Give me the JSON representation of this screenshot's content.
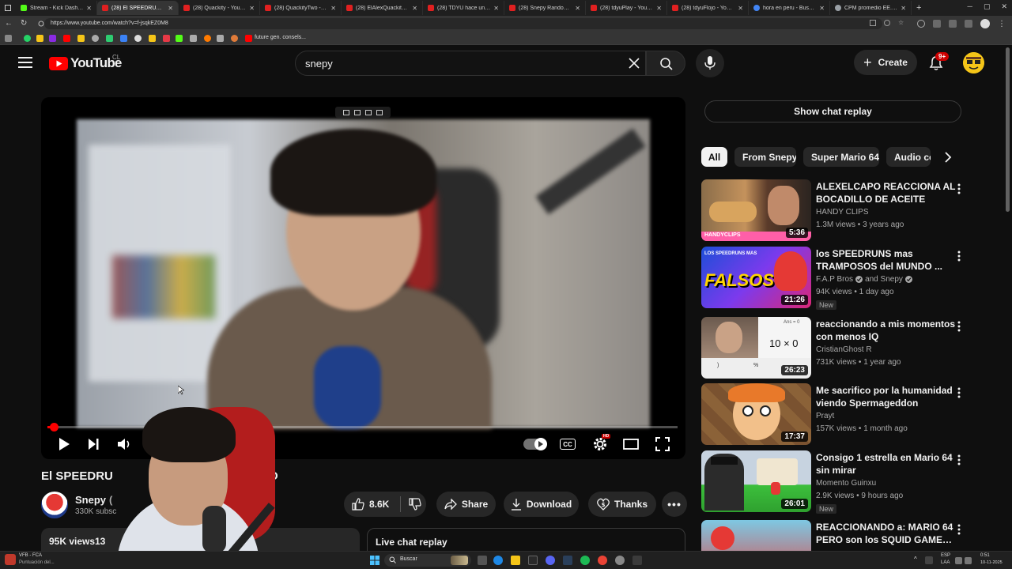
{
  "browser": {
    "tabs": [
      {
        "label": "Stream - Kick Dashboard",
        "favicon": "kick"
      },
      {
        "label": "(28) El SPEEDRUN PERFECTO",
        "favicon": "youtube",
        "active": true
      },
      {
        "label": "(28) Quackity - YouTube",
        "favicon": "youtube"
      },
      {
        "label": "(28) QuackityTwo - YouTube",
        "favicon": "youtube"
      },
      {
        "label": "(28) ElAlexQuackity - YouTube",
        "favicon": "youtube"
      },
      {
        "label": "(28) TDYU hace un TIER",
        "favicon": "youtube"
      },
      {
        "label": "(28) Snepy Random - YouTube",
        "favicon": "youtube"
      },
      {
        "label": "(28) tdyuPlay - YouTube",
        "favicon": "youtube"
      },
      {
        "label": "(28) tdyuFlojo - YouTube",
        "favicon": "youtube"
      },
      {
        "label": "hora en peru - Buscar con Google",
        "favicon": "google"
      },
      {
        "label": "CPM promedio EE.UU.",
        "favicon": "globe"
      }
    ],
    "url": "https://www.youtube.com/watch?v=f-jsqkEZ0M8",
    "bookmark_label": "future gen. consels..."
  },
  "youtube": {
    "logo_text": "YouTube",
    "region": "CL",
    "search_value": "snepy",
    "create_label": "Create",
    "notification_count": "9+"
  },
  "video": {
    "title_visible": "El SPEEDRU",
    "title_tail": "O",
    "progress": 0.01,
    "channel_name": "Snepy",
    "channel_name_tail": "(",
    "subscribers": "330K subsc",
    "like_count": "8.6K",
    "share_label": "Share",
    "download_label": "Download",
    "thanks_label": "Thanks",
    "views": "95K views",
    "views_tail": "13",
    "live_chat_label": "Live chat replay"
  },
  "sidebar": {
    "show_chat_replay": "Show chat replay",
    "chips": [
      "All",
      "From Snepy",
      "Super Mario 64",
      "Audio co"
    ],
    "recommendations": [
      {
        "title": "ALEXELCAPO REACCIONA AL BOCADILLO DE ACEITE",
        "channel": "HANDY CLIPS",
        "verified": false,
        "meta": "1.3M views • 3 years ago",
        "duration": "5:36",
        "badge": ""
      },
      {
        "title": "los SPEEDRUNS mas TRAMPOSOS del MUNDO ...",
        "channel": "F.A.P Bros",
        "channel2": "and Snepy",
        "verified": true,
        "meta": "94K views • 1 day ago",
        "duration": "21:26",
        "badge": "New"
      },
      {
        "title": "reaccionando a mis momentos con menos IQ",
        "channel": "CristianGhost R",
        "verified": false,
        "meta": "731K views • 1 year ago",
        "duration": "26:23",
        "badge": ""
      },
      {
        "title": "Me sacrifico por la humanidad viendo Spermageddon",
        "channel": "Prayt",
        "verified": false,
        "meta": "157K views • 1 month ago",
        "duration": "17:37",
        "badge": ""
      },
      {
        "title": "Consigo 1 estrella en Mario 64 sin mirar",
        "channel": "Momento Guinxu",
        "verified": false,
        "meta": "2.9K views • 9 hours ago",
        "duration": "26:01",
        "badge": "New"
      },
      {
        "title": "REACCIONANDO a: MARIO 64 PERO son los SQUID GAMES ...",
        "channel": "",
        "verified": false,
        "meta": "",
        "duration": "",
        "badge": ""
      }
    ],
    "thumb3_text": {
      "small": "Ans = 0",
      "big": "10 × 0",
      "k1": ")",
      "k2": "%"
    },
    "thumb2_text": {
      "big": "FALSOS",
      "small": "LOS SPEEDRUNS MAS"
    },
    "thumb1_text": "HANDYCLIPS"
  },
  "taskbar": {
    "search_label": "Buscar",
    "widget_line1": "VFB - FCA",
    "widget_line2": "Puntuación del...",
    "lang_line1": "ESP",
    "lang_line2": "LAA",
    "time": "0:51",
    "date": "10-11-2025"
  },
  "colors": {
    "yt_red": "#ff0000",
    "background": "#0f0f0f",
    "chip_bg": "#272727",
    "meta_text": "#aaaaaa"
  }
}
